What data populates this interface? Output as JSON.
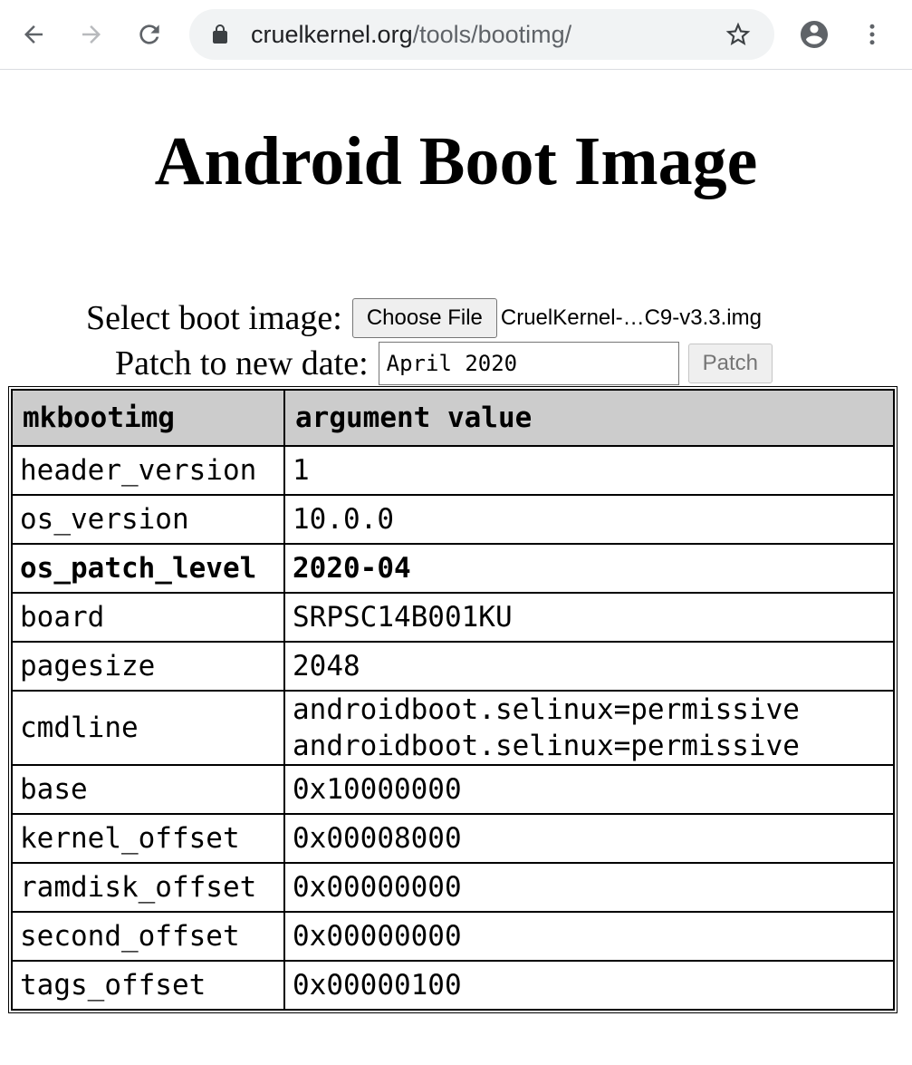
{
  "browser": {
    "url_host": "cruelkernel.org",
    "url_path": "/tools/bootimg/"
  },
  "page": {
    "title": "Android Boot Image",
    "select_label": "Select boot image:",
    "choose_file_label": "Choose File",
    "file_name": "CruelKernel-…C9-v3.3.img",
    "patch_label": "Patch to new date:",
    "date_value": "April 2020",
    "patch_button_label": "Patch"
  },
  "table": {
    "headers": [
      "mkbootimg",
      "argument value"
    ],
    "rows": [
      {
        "name": "header_version",
        "value": "1"
      },
      {
        "name": "os_version",
        "value": "10.0.0"
      },
      {
        "name": "os_patch_level",
        "value": "2020-04",
        "bold": true
      },
      {
        "name": "board",
        "value": "SRPSC14B001KU"
      },
      {
        "name": "pagesize",
        "value": "2048"
      },
      {
        "name": "cmdline",
        "lines": [
          "androidboot.selinux=permissive",
          "androidboot.selinux=permissive"
        ]
      },
      {
        "name": "base",
        "value": "0x10000000"
      },
      {
        "name": "kernel_offset",
        "value": "0x00008000"
      },
      {
        "name": "ramdisk_offset",
        "value": "0x00000000"
      },
      {
        "name": "second_offset",
        "value": "0x00000000"
      },
      {
        "name": "tags_offset",
        "value": "0x00000100"
      }
    ]
  }
}
